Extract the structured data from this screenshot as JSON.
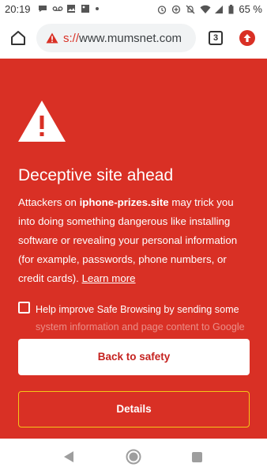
{
  "status_bar": {
    "time": "20:19",
    "battery": "65 %",
    "left_icons": [
      "messenger-icon",
      "voicemail-icon",
      "photo-icon",
      "image-icon",
      "dot-icon"
    ],
    "right_icons": [
      "alarm-icon",
      "data-saver-icon",
      "mute-icon",
      "wifi-icon",
      "signal-icon",
      "battery-icon"
    ]
  },
  "toolbar": {
    "url_scheme": "s://",
    "url_host": "www.mumsnet.com",
    "tab_count": "3"
  },
  "interstitial": {
    "heading": "Deceptive site ahead",
    "body_prefix": "Attackers on ",
    "site": "iphone-prizes.site",
    "body_suffix": " may trick you into doing something dangerous like installing software or revealing your personal information (for example, passwords, phone numbers, or credit cards).",
    "learn_more": "Learn more",
    "checkbox_label": "Help improve Safe Browsing by sending some",
    "checkbox_label_faded": "system information and page content to Google",
    "back_button": "Back to safety",
    "details_button": "Details",
    "background_color": "#d93025"
  },
  "nav_bar": {
    "icons": [
      "back-icon",
      "home-icon",
      "recents-icon"
    ]
  }
}
